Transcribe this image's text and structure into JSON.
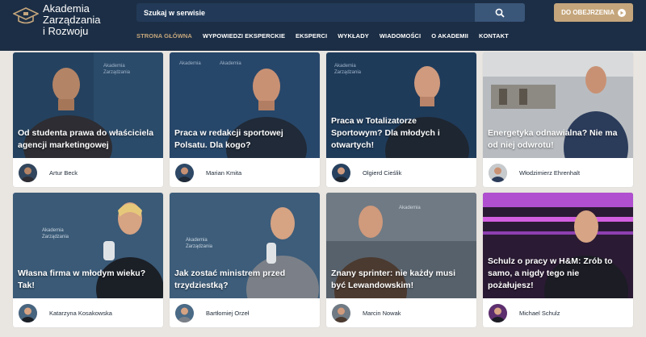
{
  "header": {
    "logo": {
      "line1": "Akademia",
      "line2": "Zarządzania",
      "line3": "i Rozwoju"
    },
    "search": {
      "placeholder": "Szukaj w serwisie",
      "value": "",
      "icon": "search-icon"
    },
    "watch_button": {
      "label": "DO OBEJRZENIA",
      "count": "0"
    },
    "nav": [
      {
        "label": "STRONA GŁÓWNA",
        "active": true
      },
      {
        "label": "WYPOWIEDZI EKSPERCKIE",
        "active": false
      },
      {
        "label": "EKSPERCI",
        "active": false
      },
      {
        "label": "WYKŁADY",
        "active": false
      },
      {
        "label": "WIADOMOŚCI",
        "active": false
      },
      {
        "label": "O AKADEMII",
        "active": false
      },
      {
        "label": "KONTAKT",
        "active": false
      }
    ]
  },
  "colors": {
    "header_bg": "#1c2e45",
    "accent": "#c5a67c",
    "page_bg": "#e9e6e2"
  },
  "cards": [
    {
      "title": "Od studenta prawa do właściciela agencji marketingowej",
      "author": "Artur Beck"
    },
    {
      "title": "Praca w redakcji sportowej Polsatu. Dla kogo?",
      "author": "Marian Kmita"
    },
    {
      "title": "Praca w Totalizatorze Sportowym? Dla młodych i otwartych!",
      "author": "Olgierd Cieślik"
    },
    {
      "title": "Energetyka odnawialna? Nie ma od niej odwrotu!",
      "author": "Włodzimierz Ehrenhalt"
    },
    {
      "title": "Własna firma w młodym wieku? Tak!",
      "author": "Katarzyna Kosakowska"
    },
    {
      "title": "Jak zostać ministrem przed trzydziestką?",
      "author": "Bartłomiej Orzeł"
    },
    {
      "title": "Znany sprinter: nie każdy musi być Lewandowskim!",
      "author": "Marcin Nowak"
    },
    {
      "title": "Schulz o pracy w H&M: Zrób to samo, a nigdy tego nie pożałujesz!",
      "author": "Michael Schulz"
    }
  ]
}
